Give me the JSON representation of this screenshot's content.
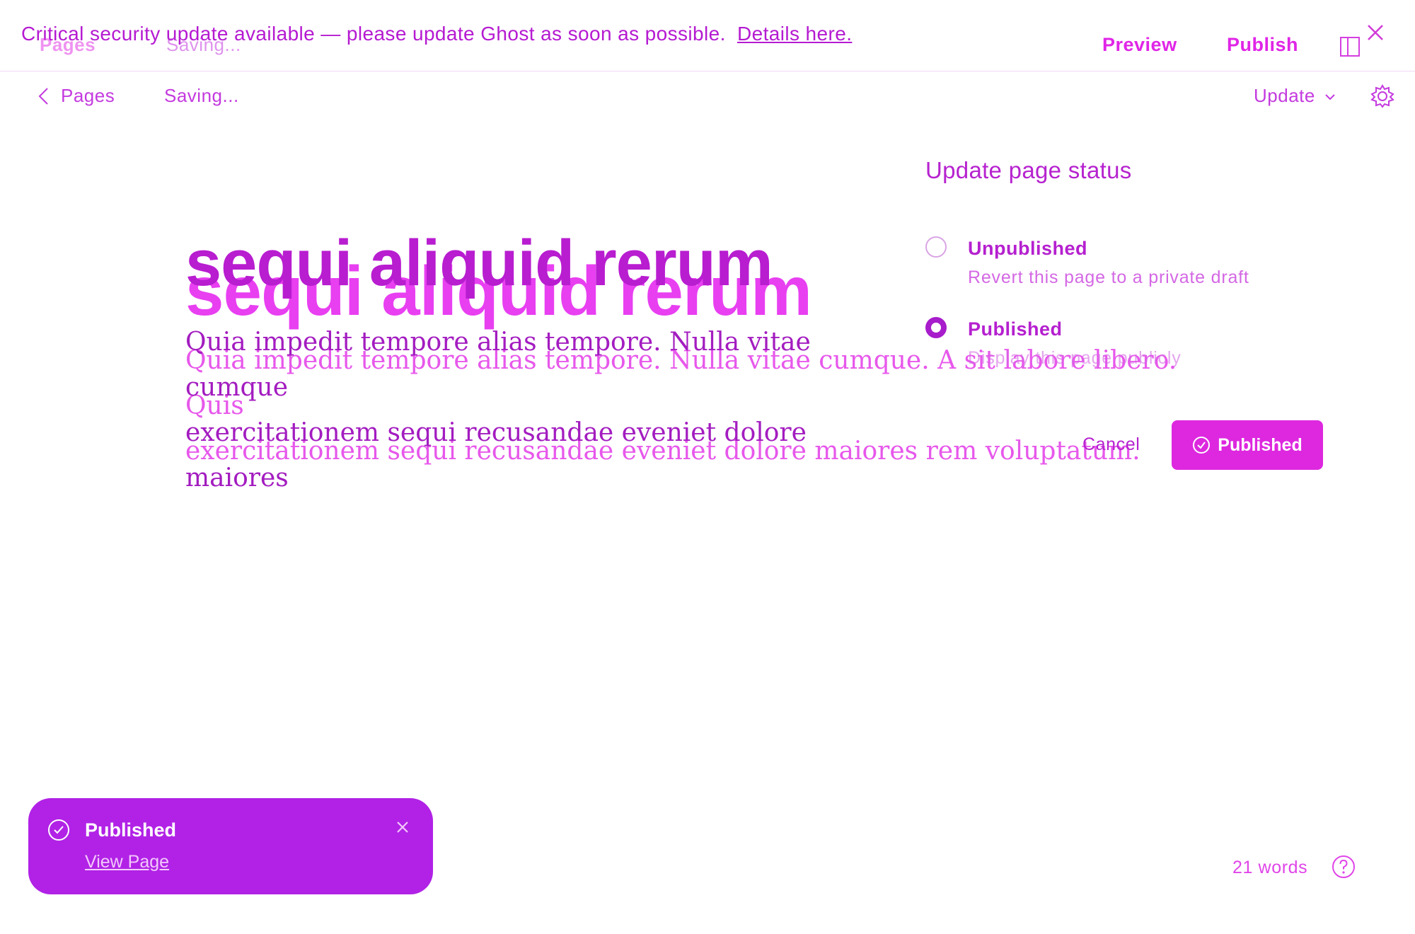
{
  "banner": {
    "text": "Critical security update available — please update Ghost as soon as possible.",
    "link": "Details here."
  },
  "header": {
    "back_label": "Pages",
    "status": "Saving...",
    "preview_label": "Preview",
    "publish_label": "Publish",
    "update_label": "Update"
  },
  "post": {
    "title": "sequi aliquid rerum",
    "body_line1": "Quia impedit tempore alias tempore. Nulla vitae cumque",
    "body_line2": "exercitationem sequi recusandae eveniet dolore maiores",
    "body_full_line1": "Quia impedit tempore alias tempore. Nulla vitae cumque. A sit labore libero. Quis",
    "body_full_line2": "exercitationem sequi recusandae eveniet dolore maiores rem voluptatum."
  },
  "status_panel": {
    "title": "Update page status",
    "options": [
      {
        "label": "Unpublished",
        "description": "Revert this page to a private draft",
        "selected": false
      },
      {
        "label": "Published",
        "description": "Display this page publicly",
        "selected": true
      }
    ],
    "cancel_label": "Cancel",
    "confirm_label": "Published"
  },
  "toast": {
    "title": "Published",
    "link": "View Page"
  },
  "footer": {
    "word_count": "21 words"
  },
  "colors": {
    "accent": "#c21bd6",
    "button": "#dd28df",
    "toast": "#b122e6"
  },
  "icons": [
    "close-icon",
    "chevron-left-icon",
    "sidebar-toggle-icon",
    "chevron-down-icon",
    "gear-icon",
    "check-circle-icon",
    "help-icon"
  ]
}
